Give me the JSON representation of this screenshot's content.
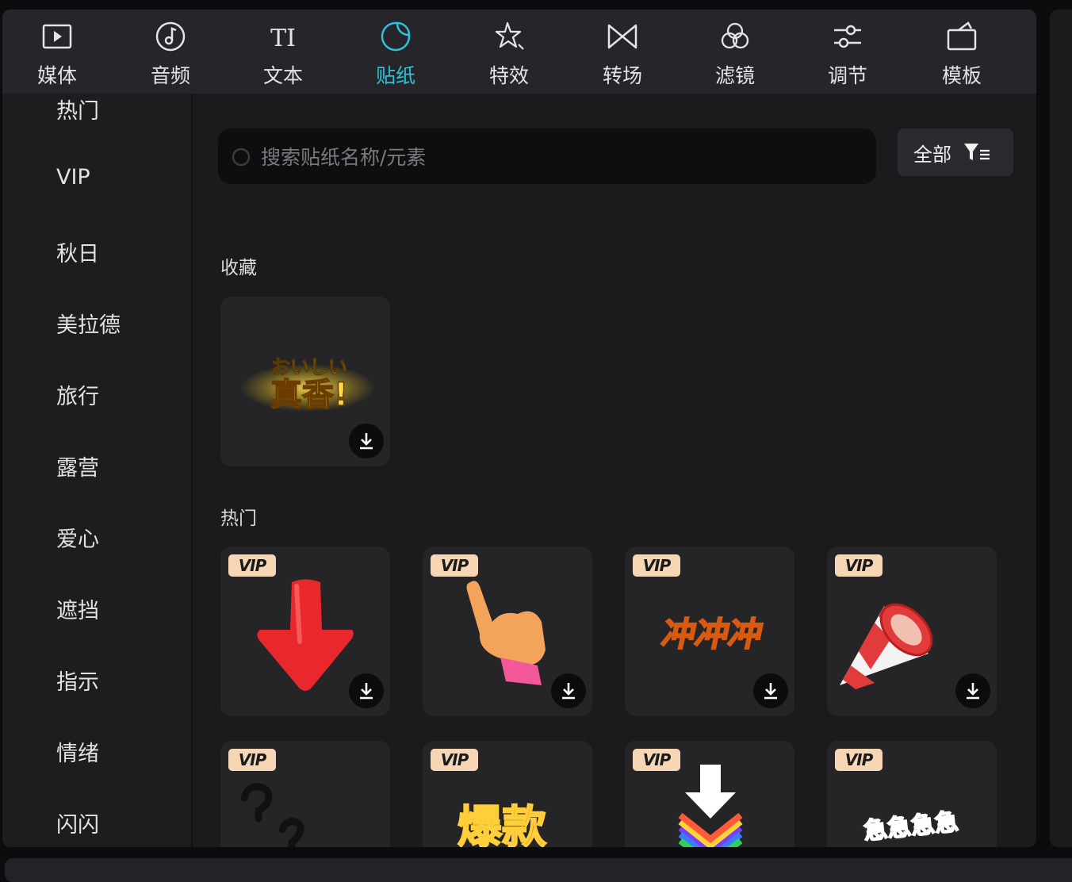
{
  "toolbar": {
    "tabs": [
      {
        "label": "媒体",
        "icon": "media-icon"
      },
      {
        "label": "音频",
        "icon": "audio-icon"
      },
      {
        "label": "文本",
        "icon": "text-icon"
      },
      {
        "label": "贴纸",
        "icon": "sticker-icon",
        "active": true
      },
      {
        "label": "特效",
        "icon": "effects-icon"
      },
      {
        "label": "转场",
        "icon": "transition-icon"
      },
      {
        "label": "滤镜",
        "icon": "filter-icon"
      },
      {
        "label": "调节",
        "icon": "adjust-icon"
      },
      {
        "label": "模板",
        "icon": "template-icon"
      }
    ],
    "text_icon_glyph": "TI"
  },
  "sidebar": {
    "items": [
      "热门",
      "VIP",
      "秋日",
      "美拉德",
      "旅行",
      "露营",
      "爱心",
      "遮挡",
      "指示",
      "情绪",
      "闪闪"
    ]
  },
  "search": {
    "placeholder": "搜索贴纸名称/元素",
    "value": ""
  },
  "filter": {
    "label": "全部"
  },
  "sections": {
    "favorites": {
      "title": "收藏",
      "items": [
        {
          "text_line1": "おいしい",
          "text_line2": "真香!"
        }
      ]
    },
    "hot": {
      "title": "热门",
      "vip_label": "VIP",
      "row1": [
        "red-arrow-sticker",
        "pointing-hand-sticker",
        "chong-chong-chong-sticker",
        "party-horn-sticker"
      ],
      "row1_text": {
        "chong": "冲冲冲"
      },
      "row2": [
        "question-marks-sticker",
        "baokuan-sticker",
        "rainbow-download-arrow-sticker",
        "jijiji-sticker"
      ],
      "row2_text": {
        "baokuan": "爆款",
        "ji": "急急急急"
      }
    }
  },
  "colors": {
    "accent": "#2fc2d8",
    "vip_badge": "#f6d6b4",
    "panel_bg": "#1b1b1e",
    "toolbar_bg": "#26262a"
  }
}
